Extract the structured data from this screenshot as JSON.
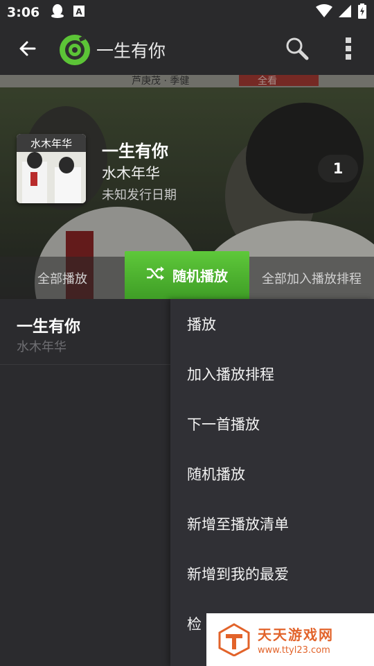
{
  "status_bar": {
    "time": "3:06",
    "icons": [
      "qq-penguin-icon",
      "font-a-icon",
      "wifi-icon",
      "signal-icon",
      "battery-charging-icon"
    ]
  },
  "app_bar": {
    "title": "一生有你",
    "back_icon": "arrow-left-icon",
    "logo_icon": "music-disc-logo-icon",
    "search_icon": "search-icon",
    "overflow_icon": "more-vert-icon"
  },
  "album": {
    "art_text": "水木年华",
    "title": "一生有你",
    "artist": "水木年华",
    "release_date": "未知发行日期",
    "track_count": "1",
    "banner_text": [
      "芦庚茂 · 季健",
      "全看"
    ]
  },
  "buttons": {
    "play_all": "全部播放",
    "shuffle": "随机播放",
    "queue_all": "全部加入播放排程"
  },
  "songs": [
    {
      "title": "一生有你",
      "artist": "水木年华"
    }
  ],
  "context_menu": {
    "items": [
      "播放",
      "加入播放排程",
      "下一首播放",
      "随机播放",
      "新增至播放清单",
      "新增到我的最爱",
      "检"
    ]
  },
  "watermark": {
    "title": "天天游戏网",
    "url": "www.ttyl23.com"
  },
  "colors": {
    "accent_green": "#4caf2a",
    "background": "#2b2b2e",
    "menu_background": "#303035",
    "watermark_orange": "#e2632a"
  }
}
